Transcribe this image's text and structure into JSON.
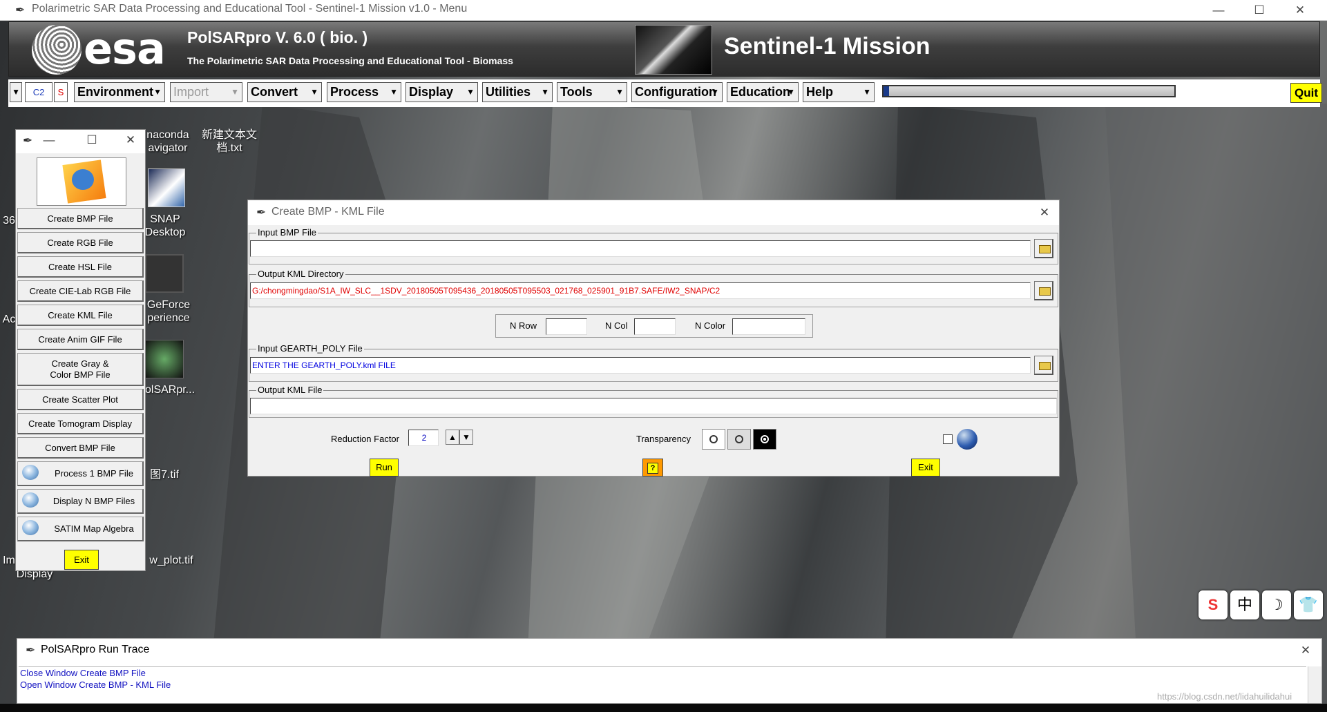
{
  "window": {
    "title": "Polarimetric SAR Data Processing and Educational Tool - Sentinel-1 Mission v1.0 - Menu",
    "min": "—",
    "max": "☐",
    "close": "✕"
  },
  "banner": {
    "esa": "esa",
    "product": "PolSARpro V. 6.0 ( bio. )",
    "subtitle": "The Polarimetric SAR Data Processing and Educational Tool - Biomass",
    "mission": "Sentinel-1 Mission"
  },
  "menubar": {
    "mode": "C2",
    "s_label": "S",
    "items": [
      "Environment",
      "Import",
      "Convert",
      "Process",
      "Display",
      "Utilities",
      "Tools",
      "Configuration",
      "Education",
      "Help"
    ],
    "progress": 0.02,
    "quit": "Quit"
  },
  "desktop": {
    "icons": [
      "naconda\navigator",
      "新建文本文\n档.txt",
      "SNAP\nDesktop",
      "GeForce\nperience",
      "olSARpr...",
      "图7.tif",
      "w_plot.tif",
      "36",
      "Ac",
      "Im",
      "Display"
    ],
    "watermark": "https://blog.csdn.net/lidahuilidahui"
  },
  "panel": {
    "buttons": [
      "Create BMP File",
      "Create RGB File",
      "Create HSL File",
      "Create CIE-Lab RGB File",
      "Create KML File",
      "Create Anim GIF File",
      "Create Gray &\nColor BMP File",
      "Create Scatter Plot",
      "Create Tomogram Display",
      "Convert BMP File",
      "Process 1 BMP File",
      "Display N BMP Files",
      "SATIM Map Algebra"
    ],
    "exit": "Exit"
  },
  "dialog": {
    "title": "Create BMP - KML File",
    "input_bmp": {
      "label": "Input BMP File",
      "value": ""
    },
    "output_dir": {
      "label": "Output KML Directory",
      "value": "G:/chongmingdao/S1A_IW_SLC__1SDV_20180505T095436_20180505T095503_021768_025901_91B7.SAFE/IW2_SNAP/C2"
    },
    "n_row": {
      "label": "N Row",
      "value": ""
    },
    "n_col": {
      "label": "N Col",
      "value": ""
    },
    "n_color": {
      "label": "N Color",
      "value": ""
    },
    "gearth": {
      "label": "Input GEARTH_POLY File",
      "value": "ENTER THE GEARTH_POLY.kml FILE"
    },
    "output_kml": {
      "label": "Output KML File",
      "value": ""
    },
    "reduction": {
      "label": "Reduction Factor",
      "value": "2"
    },
    "transparency": {
      "label": "Transparency"
    },
    "run": "Run",
    "help": "?",
    "exit": "Exit",
    "colors": {
      "output_dir_text": "#e00000",
      "gearth_text": "#0000e0"
    }
  },
  "trace": {
    "title": "PolSARpro Run Trace",
    "lines": [
      "Close Window Create BMP File",
      "Open Window Create BMP - KML File"
    ]
  },
  "tray": [
    "S",
    "中",
    "☽",
    "👕"
  ]
}
